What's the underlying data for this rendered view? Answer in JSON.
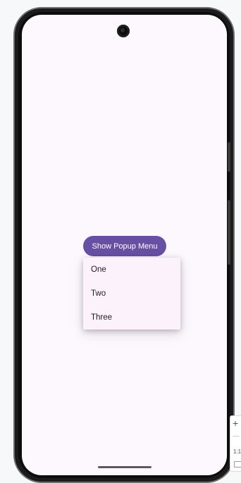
{
  "app": {
    "button_label": "Show Popup Menu"
  },
  "popup_menu": {
    "items": [
      {
        "label": "One"
      },
      {
        "label": "Two"
      },
      {
        "label": "Three"
      }
    ]
  },
  "emulator_controls": {
    "zoom_in_symbol": "+",
    "ratio_label": "1:1"
  },
  "colors": {
    "accent": "#6750a4",
    "screen_background": "#fdf7fe",
    "menu_background": "#fbf2fb",
    "text": "#1d1b20"
  },
  "icons": {
    "zoom_in": "plus-icon",
    "fit": "fit-screen-icon",
    "camera": "front-camera-icon"
  }
}
